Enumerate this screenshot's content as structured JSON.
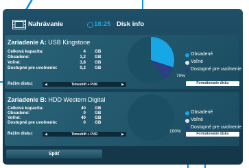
{
  "header": {
    "title": "Nahrávanie",
    "time": "18:25",
    "section": "Disk info"
  },
  "disk_a": {
    "title_prefix": "Zariadenie A:",
    "title_name": "USB Kingstone",
    "rows": [
      {
        "label": "Celková kapacita:",
        "value": "4",
        "unit": "GB"
      },
      {
        "label": "Obsadené:",
        "value": "1,2",
        "unit": "GB"
      },
      {
        "label": "Voľné:",
        "value": "3,8",
        "unit": "GB"
      },
      {
        "label": "Dostupné pre uvolnenie:",
        "value": "0,2",
        "unit": "GB"
      }
    ],
    "mode_label": "Režim disku:",
    "mode_value": "Timeshift + PVR",
    "percent_text": "70%",
    "format_label": "Formátovanie disku",
    "pie": {
      "used": 0.3,
      "free": 0.6,
      "releasable": 0.1
    }
  },
  "disk_b": {
    "title_prefix": "Zariadenie B:",
    "title_name": "HDD Western Digital",
    "rows": [
      {
        "label": "Celková kapacita:",
        "value": "40",
        "unit": "GB"
      },
      {
        "label": "Obsadené:",
        "value": "0",
        "unit": "GB"
      },
      {
        "label": "Voľné:",
        "value": "40",
        "unit": "GB"
      },
      {
        "label": "Dostupné pre uvolnenie:",
        "value": "0",
        "unit": "GB"
      }
    ],
    "mode_label": "Režim disku:",
    "mode_value": "Timeshift + PVR",
    "percent_text": "100%",
    "format_label": "Formátovanie disku"
  },
  "legend": [
    {
      "label": "Obsadené",
      "color": "#17a7e6"
    },
    {
      "label": "Voľné",
      "color": "#d9e7ee"
    },
    {
      "label": "Dostupné pre uvolnenie",
      "color": "#2c3e86"
    }
  ],
  "back_label": "Späť",
  "colors": {
    "accent": "#17a7e6",
    "panel": "#245a70",
    "callout": "#0a8fd8"
  }
}
